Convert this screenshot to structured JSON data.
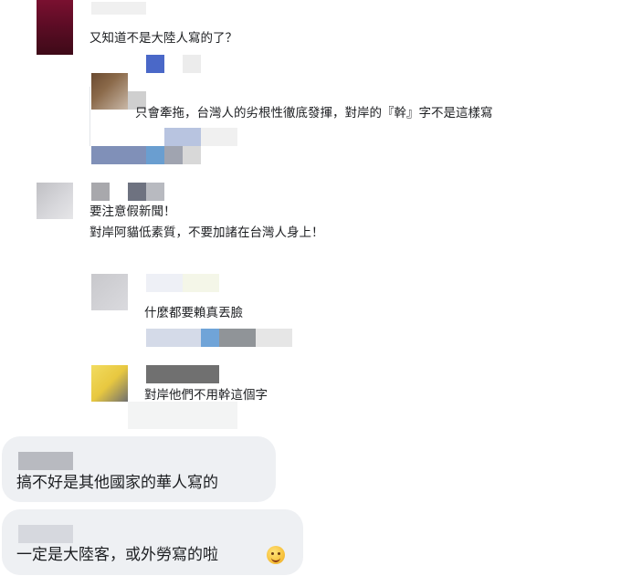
{
  "comments": [
    {
      "id": "c1",
      "text": "又知道不是大陸人寫的了？"
    },
    {
      "id": "c2",
      "text": "只會牽拖，台灣人的劣根性徹底發揮，對岸的『幹』字不是這樣寫"
    },
    {
      "id": "c3",
      "line1": "要注意假新聞！",
      "line2": "對岸阿貓低素質，不要加諸在台灣人身上！"
    },
    {
      "id": "c4",
      "text": "什麼都要賴真丟臉"
    },
    {
      "id": "c5",
      "text": "對岸他們不用幹這個字"
    },
    {
      "id": "c6",
      "text": "搞不好是其他國家的華人寫的"
    },
    {
      "id": "c7",
      "text": "一定是大陸客，或外勞寫的啦"
    }
  ],
  "icons": {
    "emoji_c7": "smiling-face-emoji-icon"
  }
}
